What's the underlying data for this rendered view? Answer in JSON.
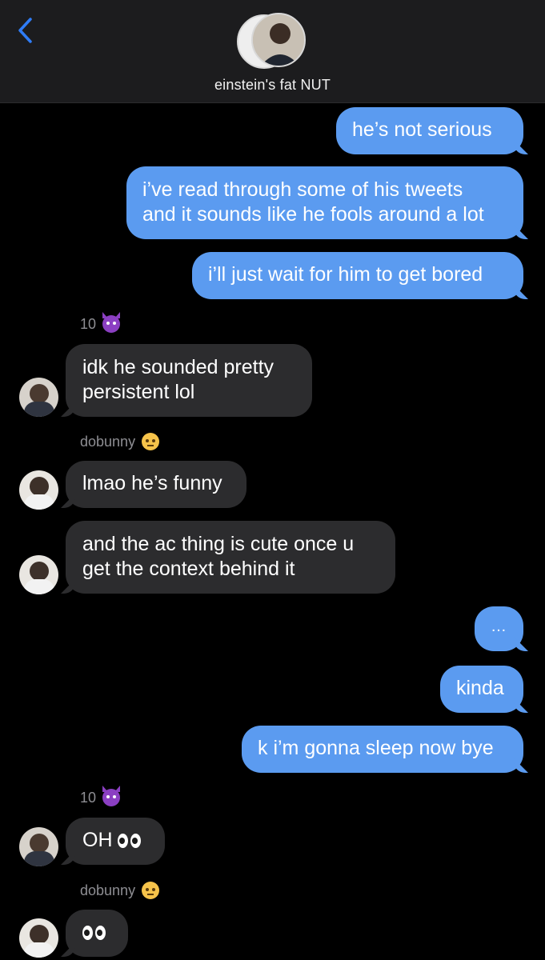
{
  "header": {
    "group_name": "einstein's fat NUT",
    "back_icon": "chevron-left-icon"
  },
  "colors": {
    "outgoing": "#5b9bf0",
    "incoming": "#2c2c2e",
    "accent": "#2f7cf6"
  },
  "messages": {
    "m1": "he’s not serious",
    "m2_l1": "i’ve read through some of his tweets",
    "m2_l2": "and it sounds like he fools around a lot",
    "m3": "i’ll just wait for him to get bored",
    "s1": "10",
    "m4_l1": "idk he sounded pretty",
    "m4_l2": "persistent lol",
    "s2": "dobunny",
    "m5": "lmao he’s funny",
    "m6_l1": "and the ac thing is cute once u",
    "m6_l2": "get the context behind it",
    "m7": "…",
    "m8": "kinda",
    "m9": "k i’m gonna sleep now bye",
    "s3": "10",
    "m10": "OH",
    "s4": "dobunny"
  }
}
